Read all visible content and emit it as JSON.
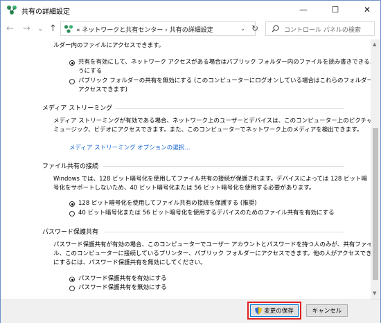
{
  "window": {
    "title": "共有の詳細設定",
    "controls": {
      "minimize": "—",
      "maximize": "☐",
      "close": "✕"
    }
  },
  "nav": {
    "back": "←",
    "forward": "→",
    "recent": "⌄",
    "up": "↑",
    "address": "«  ネットワークと共有センター  ›  共有の詳細設定",
    "dropdown": "⌄",
    "refresh": "↻",
    "search_placeholder": "コントロール パネルの検索"
  },
  "public_folder": {
    "cut_line": "ルダー内のファイルにアクセスできます。",
    "options": [
      {
        "line1": "共有を有効にして、ネットワーク アクセスがある場合はパブリック フォルダー内のファイルを読み書きできるよ",
        "line2": "うにする",
        "selected": true
      },
      {
        "line1": "パブリック フォルダーの共有を無効にする (このコンピューターにログオンしている場合はこれらのフォルダーに",
        "line2": "アクセスできます)",
        "selected": false
      }
    ]
  },
  "media": {
    "title": "メディア ストリーミング",
    "desc1": "メディア ストリーミングが有効である場合、ネットワーク上のユーザーとデバイスは、このコンピューター上のピクチャ、",
    "desc2": "ミュージック、ビデオにアクセスできます。また、このコンピューターでネットワーク上のメディアを検出できます。",
    "link": "メディア ストリーミング オプションの選択..."
  },
  "file_sharing": {
    "title": "ファイル共有の接続",
    "desc1": "Windows では、128 ビット暗号化を使用してファイル共有の接続が保護されます。デバイスによっては 128 ビット暗",
    "desc2": "号化をサポートしないため、40 ビット暗号化または 56 ビット暗号化を使用する必要があります。",
    "options": [
      {
        "label": "128 ビット暗号化を使用してファイル共有の接続を保護する (推奨)",
        "selected": true
      },
      {
        "label": "40 ビット暗号化または 56 ビット暗号化を使用するデバイスのためのファイル共有を有効にする",
        "selected": false
      }
    ]
  },
  "password": {
    "title": "パスワード保護共有",
    "desc1": "パスワード保護共有が有効の場合、このコンピューターでユーザー アカウントとパスワードを持つ人のみが、共有ファイ",
    "desc2": "ル、このコンピューターに接続しているプリンター、パブリック フォルダーにアクセスできます。他の人がアクセスできるよう",
    "desc3": "にするには、パスワード保護共有を無効にしてください。",
    "options": [
      {
        "label": "パスワード保護共有を有効にする",
        "selected": true
      },
      {
        "label": "パスワード保護共有を無効にする",
        "selected": false
      }
    ]
  },
  "footer": {
    "save": "変更の保存",
    "cancel": "キャンセル"
  },
  "colors": {
    "link": "#0b5fce",
    "highlight": "#e02020",
    "accent": "#0078d7"
  },
  "icons": [
    "network-icon",
    "search-icon",
    "shield-icon"
  ]
}
